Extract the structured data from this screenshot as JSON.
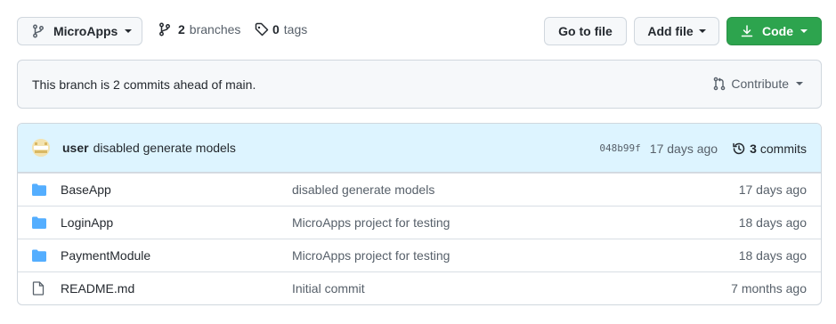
{
  "branch": {
    "name": "MicroApps",
    "icon": "git-branch-icon"
  },
  "branches": {
    "count": "2",
    "label": "branches"
  },
  "tags": {
    "count": "0",
    "label": "tags"
  },
  "actions": {
    "go_to_file": "Go to file",
    "add_file": "Add file",
    "code": "Code"
  },
  "ahead": {
    "text": "This branch is 2 commits ahead of main.",
    "contribute": "Contribute"
  },
  "commit": {
    "author": "user",
    "message": "disabled generate models",
    "sha": "048b99f",
    "age": "17 days ago",
    "count": "3",
    "count_label": "commits"
  },
  "files": [
    {
      "type": "folder",
      "icon": "folder-icon",
      "name": "BaseApp",
      "message": "disabled generate models",
      "age": "17 days ago"
    },
    {
      "type": "folder",
      "icon": "folder-icon",
      "name": "LoginApp",
      "message": "MicroApps project for testing",
      "age": "18 days ago"
    },
    {
      "type": "folder",
      "icon": "folder-icon",
      "name": "PaymentModule",
      "message": "MicroApps project for testing",
      "age": "18 days ago"
    },
    {
      "type": "file",
      "icon": "file-icon",
      "name": "README.md",
      "message": "Initial commit",
      "age": "7 months ago"
    }
  ],
  "colors": {
    "code_button": "#2da44e",
    "folder": "#54aeff",
    "commit_bar": "#ddf4ff"
  }
}
